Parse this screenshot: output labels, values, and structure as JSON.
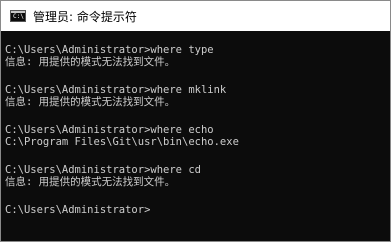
{
  "window": {
    "title": "管理员: 命令提示符",
    "icon_text": "C:\\"
  },
  "console": {
    "blocks": [
      [
        "C:\\Users\\Administrator>where type",
        "信息: 用提供的模式无法找到文件。"
      ],
      [
        "C:\\Users\\Administrator>where mklink",
        "信息: 用提供的模式无法找到文件。"
      ],
      [
        "C:\\Users\\Administrator>where echo",
        "C:\\Program Files\\Git\\usr\\bin\\echo.exe"
      ],
      [
        "C:\\Users\\Administrator>where cd",
        "信息: 用提供的模式无法找到文件。"
      ],
      [
        "C:\\Users\\Administrator>"
      ]
    ]
  },
  "colors": {
    "background": "#0c0c0c",
    "text": "#cccccc",
    "titlebar": "#ffffff"
  }
}
